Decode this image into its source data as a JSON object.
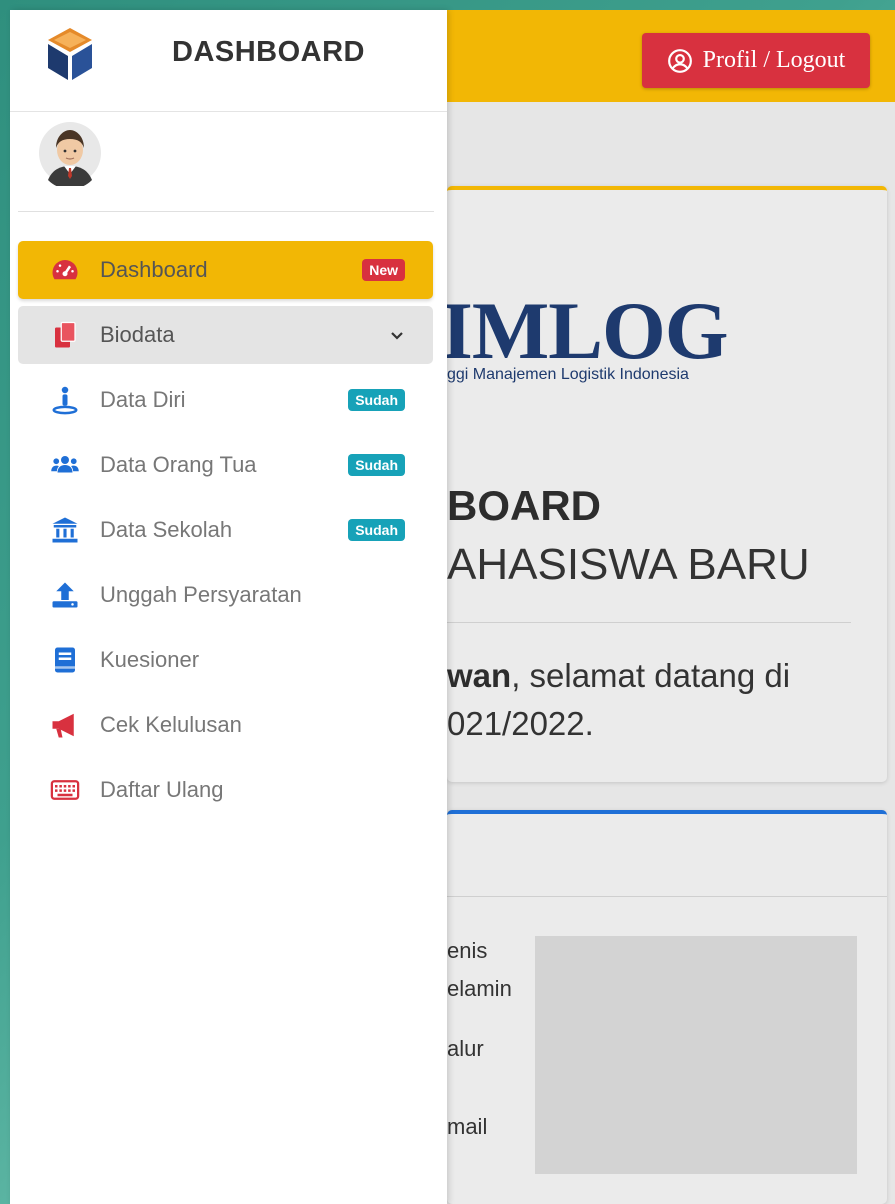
{
  "topbar": {
    "profile_label": "Profil / Logout"
  },
  "hero": {
    "brand": "IMLOG",
    "brand_sub": "ggi Manajemen Logistik Indonesia",
    "title": "BOARD",
    "subtitle": "AHASISWA BARU",
    "welcome_name": "wan",
    "welcome_rest": ", selamat datang di",
    "welcome_line2": "021/2022."
  },
  "info": {
    "labels": [
      "enis",
      "elamin",
      "alur",
      "mail"
    ]
  },
  "sidebar": {
    "title": "DASHBOARD",
    "items": [
      {
        "label": "Dashboard",
        "icon": "tachometer-icon",
        "badge": "New"
      },
      {
        "label": "Biodata",
        "icon": "copy-icon"
      },
      {
        "label": "Data Diri",
        "icon": "person-pin-icon",
        "badge": "Sudah"
      },
      {
        "label": "Data Orang Tua",
        "icon": "users-icon",
        "badge": "Sudah"
      },
      {
        "label": "Data Sekolah",
        "icon": "university-icon",
        "badge": "Sudah"
      },
      {
        "label": "Unggah Persyaratan",
        "icon": "upload-icon"
      },
      {
        "label": "Kuesioner",
        "icon": "book-icon"
      },
      {
        "label": "Cek Kelulusan",
        "icon": "bullhorn-icon"
      },
      {
        "label": "Daftar Ulang",
        "icon": "keyboard-icon"
      }
    ]
  },
  "colors": {
    "accent_yellow": "#f2b705",
    "danger_red": "#d8313f",
    "info_teal": "#17a2b8",
    "primary_blue": "#1f6fd6",
    "brand_navy": "#1e3a6e"
  }
}
